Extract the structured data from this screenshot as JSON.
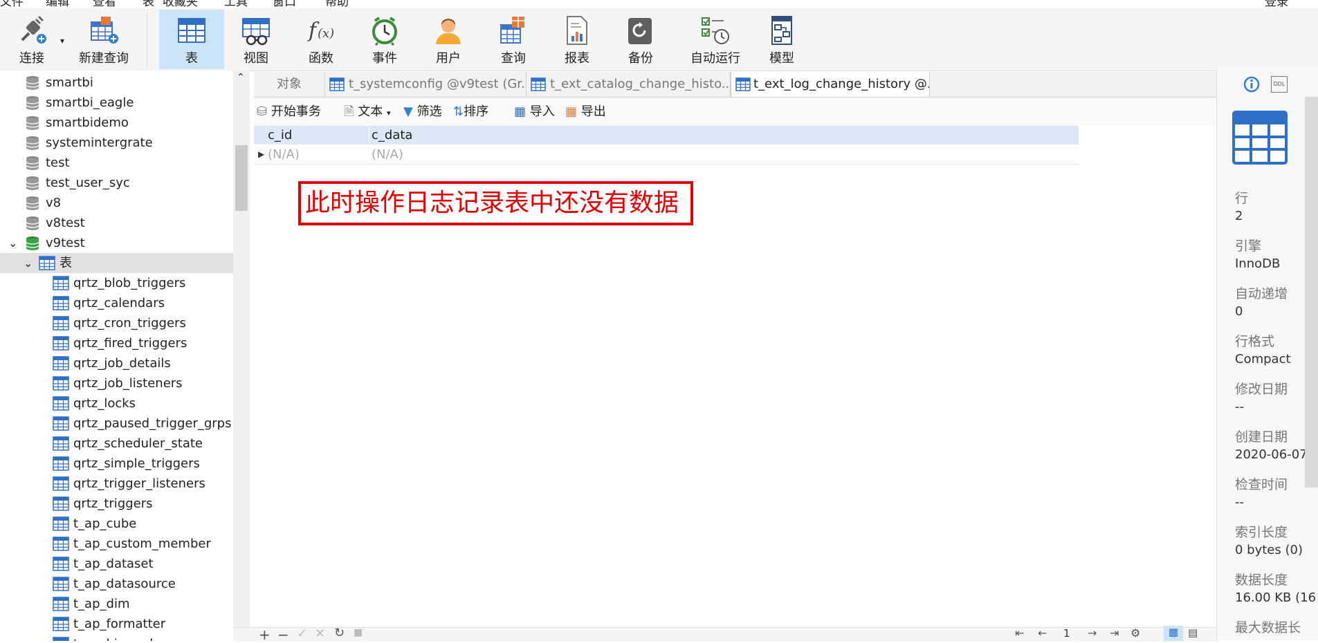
{
  "menu": {
    "items": [
      "文件",
      "编辑",
      "查看",
      "表",
      "收藏夹",
      "工具",
      "窗口",
      "帮助"
    ],
    "right": "登录"
  },
  "toolbar": {
    "items": [
      {
        "label": "连接",
        "icon": "connect-icon"
      },
      {
        "label": "新建查询",
        "icon": "new-query-icon"
      },
      {
        "label": "表",
        "icon": "table-icon"
      },
      {
        "label": "视图",
        "icon": "view-icon"
      },
      {
        "label": "函数",
        "icon": "function-icon"
      },
      {
        "label": "事件",
        "icon": "event-icon"
      },
      {
        "label": "用户",
        "icon": "user-icon"
      },
      {
        "label": "查询",
        "icon": "query-icon"
      },
      {
        "label": "报表",
        "icon": "report-icon"
      },
      {
        "label": "备份",
        "icon": "backup-icon"
      },
      {
        "label": "自动运行",
        "icon": "automation-icon"
      },
      {
        "label": "模型",
        "icon": "model-icon"
      }
    ]
  },
  "tree": {
    "databases": [
      "smartbi",
      "smartbi_eagle",
      "smartbidemo",
      "systemintergrate",
      "test",
      "test_user_syc",
      "v8",
      "v8test",
      "v9test"
    ],
    "tables_node": "表",
    "tables": [
      "qrtz_blob_triggers",
      "qrtz_calendars",
      "qrtz_cron_triggers",
      "qrtz_fired_triggers",
      "qrtz_job_details",
      "qrtz_job_listeners",
      "qrtz_locks",
      "qrtz_paused_trigger_grps",
      "qrtz_scheduler_state",
      "qrtz_simple_triggers",
      "qrtz_trigger_listeners",
      "qrtz_triggers",
      "t_ap_cube",
      "t_ap_custom_member",
      "t_ap_dataset",
      "t_ap_datasource",
      "t_ap_dim",
      "t_ap_formatter",
      "t_ap_hierarchy"
    ]
  },
  "tabs": [
    "对象",
    "t_systemconfig @v9test (Gr...",
    "t_ext_catalog_change_histo...",
    "t_ext_log_change_history @..."
  ],
  "subtoolbar": {
    "begin_tx": "开始事务",
    "text": "文本",
    "filter": "筛选",
    "sort": "排序",
    "import": "导入",
    "export": "导出"
  },
  "grid": {
    "columns": [
      "c_id",
      "c_data"
    ],
    "rows": [
      [
        "(N/A)",
        "(N/A)"
      ]
    ]
  },
  "annotation": "此时操作日志记录表中还没有数据",
  "pagination": {
    "page": "1"
  },
  "info": [
    {
      "label": "行",
      "value": "2"
    },
    {
      "label": "引擎",
      "value": "InnoDB"
    },
    {
      "label": "自动递增",
      "value": "0"
    },
    {
      "label": "行格式",
      "value": "Compact"
    },
    {
      "label": "修改日期",
      "value": "--"
    },
    {
      "label": "创建日期",
      "value": "2020-06-07"
    },
    {
      "label": "检查时间",
      "value": "--"
    },
    {
      "label": "索引长度",
      "value": "0 bytes (0)"
    },
    {
      "label": "数据长度",
      "value": "16.00 KB (16"
    },
    {
      "label": "最大数据长",
      "value": ""
    }
  ],
  "info_icons": {
    "ddl": "DDL"
  },
  "colors": {
    "accent": "#cce4f7",
    "grid_header": "#dbe9f6",
    "annotation": "#e00000",
    "db_active": "#2e8b3a"
  }
}
